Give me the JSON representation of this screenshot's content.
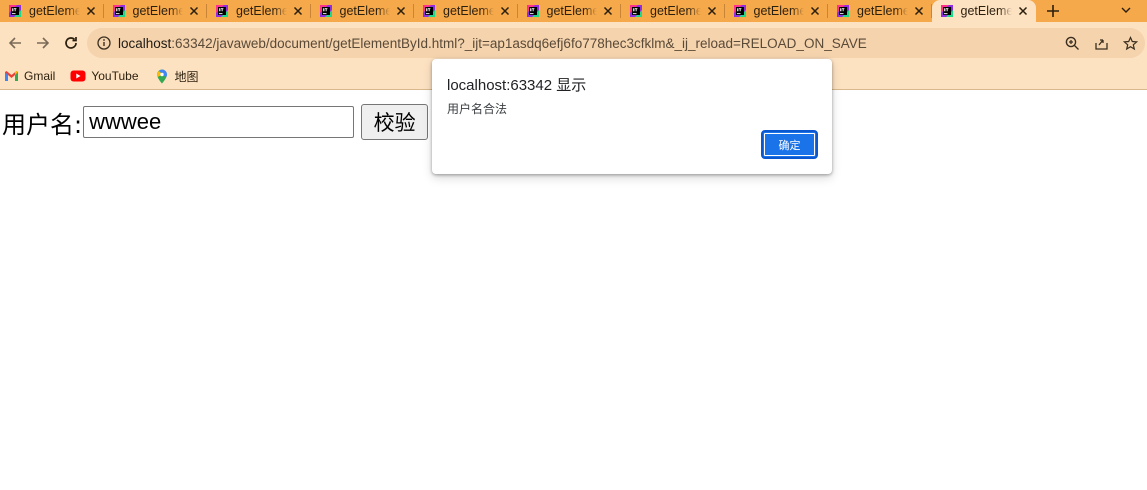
{
  "tabs": [
    {
      "title": "getElementById.html",
      "active": false
    },
    {
      "title": "getElementById.html",
      "active": false
    },
    {
      "title": "getElementById.html",
      "active": false
    },
    {
      "title": "getElementById.html",
      "active": false
    },
    {
      "title": "getElementById.html",
      "active": false
    },
    {
      "title": "getElementById.html",
      "active": false
    },
    {
      "title": "getElementById.html",
      "active": false
    },
    {
      "title": "getElementById.html",
      "active": false
    },
    {
      "title": "getElementById.html",
      "active": false
    },
    {
      "title": "getElementById.html",
      "active": true
    }
  ],
  "toolbar": {
    "url_host": "localhost",
    "url_rest": ":63342/javaweb/document/getElementById.html?_ijt=ap1asdq6efj6fo778hec3cfklm&_ij_reload=RELOAD_ON_SAVE"
  },
  "bookmarks": [
    {
      "label": "Gmail",
      "icon": "gmail-icon"
    },
    {
      "label": "YouTube",
      "icon": "youtube-icon"
    },
    {
      "label": "地图",
      "icon": "maps-icon"
    }
  ],
  "page": {
    "label": "用户名:",
    "input_value": "wwwee",
    "button_label": "校验"
  },
  "dialog": {
    "title": "localhost:63342 显示",
    "message": "用户名合法",
    "ok_label": "确定"
  },
  "colors": {
    "tabstrip": "#f6a94b",
    "toolbar": "#fde2c2",
    "omnibox": "#f4d3ad",
    "accent": "#1a73e8"
  }
}
